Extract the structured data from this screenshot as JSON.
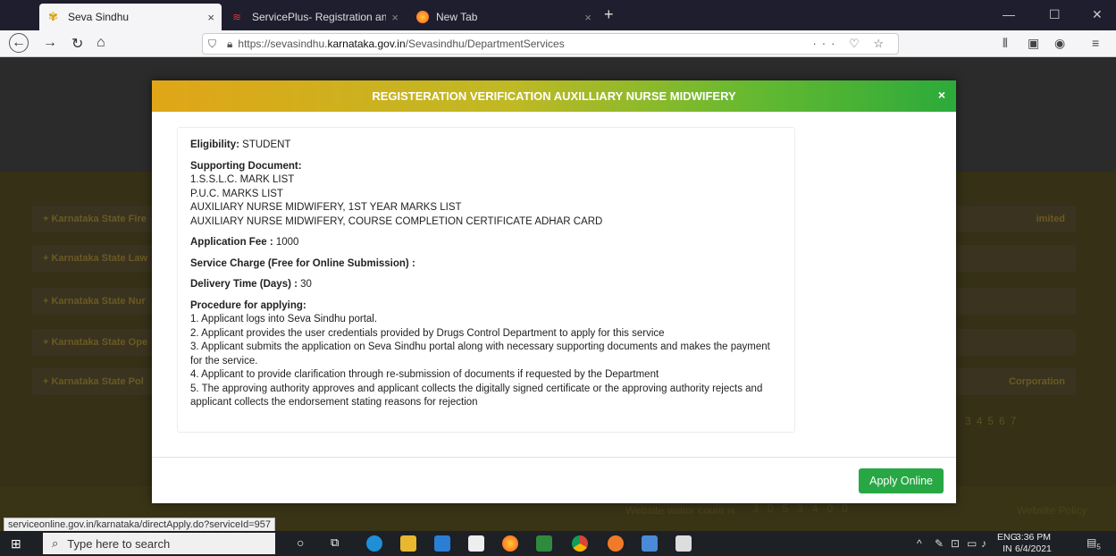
{
  "browser": {
    "tabs": [
      {
        "label": "Seva Sindhu",
        "close": "×"
      },
      {
        "label": "ServicePlus- Registration and V",
        "close": "×"
      },
      {
        "label": "New Tab",
        "close": "×"
      }
    ],
    "new_tab": "+",
    "window_controls": {
      "minimize": "—",
      "maximize": "☐",
      "close": "✕"
    },
    "url_prefix": "https://sevasindhu.",
    "url_host": "karnataka.gov.in",
    "url_path": "/Sevasindhu/DepartmentServices",
    "url_actions": "··· ♡ ☆"
  },
  "background": {
    "rows": [
      "+ Karnataka State Fire",
      "+ Karnataka State Law",
      "+ Karnataka State Nur",
      "+ Karnataka State Ope",
      "+ Karnataka State Pol"
    ],
    "right_texts": [
      "imited",
      "Corporation"
    ],
    "pager": [
      "3",
      "4",
      "5",
      "6",
      "7"
    ],
    "visitor_label": "Website visitor count is",
    "visitor_digits": [
      "3",
      "0",
      "5",
      "3",
      "4",
      "0",
      "0"
    ],
    "website_policy": "Website Policy"
  },
  "modal": {
    "title": "REGISTERATION VERIFICATION AUXILLIARY NURSE MIDWIFERY",
    "close": "×",
    "eligibility_label": "Eligibility:",
    "eligibility_value": "STUDENT",
    "supporting_label": "Supporting Document:",
    "supporting_docs": [
      "1.S.S.L.C. MARK LIST",
      "P.U.C. MARKS LIST",
      "AUXILIARY NURSE MIDWIFERY, 1ST YEAR MARKS LIST",
      "AUXILIARY NURSE MIDWIFERY, COURSE COMPLETION CERTIFICATE ADHAR CARD"
    ],
    "fee_label": "Application Fee :",
    "fee_value": "1000",
    "service_charge_label": "Service Charge (Free for Online Submission) :",
    "delivery_label": "Delivery Time (Days) :",
    "delivery_value": "30",
    "procedure_label": "Procedure for applying:",
    "procedure_steps": [
      "1. Applicant logs into Seva Sindhu portal.",
      "2. Applicant provides the user credentials provided by Drugs Control Department to apply for this service",
      "3. Applicant submits the application on Seva Sindhu portal along with necessary supporting documents and makes the payment for the service.",
      "4. Applicant to provide clarification through re-submission of documents if requested by the Department",
      "5. The approving authority approves and applicant collects the digitally signed certificate or the approving authority rejects and applicant collects the endorsement stating reasons for rejection"
    ],
    "apply_button": "Apply Online"
  },
  "status_bar": "serviceonline.gov.in/karnataka/directApply.do?serviceId=957",
  "taskbar": {
    "search_placeholder": "Type here to search",
    "lang_top": "ENG",
    "lang_bottom": "IN",
    "time": "3:36 PM",
    "date": "6/4/2021",
    "notification_count": "5"
  },
  "colors": {
    "apply_button": "#28a745",
    "header_gradient_start": "#e0a618",
    "header_gradient_end": "#2caa3a"
  }
}
